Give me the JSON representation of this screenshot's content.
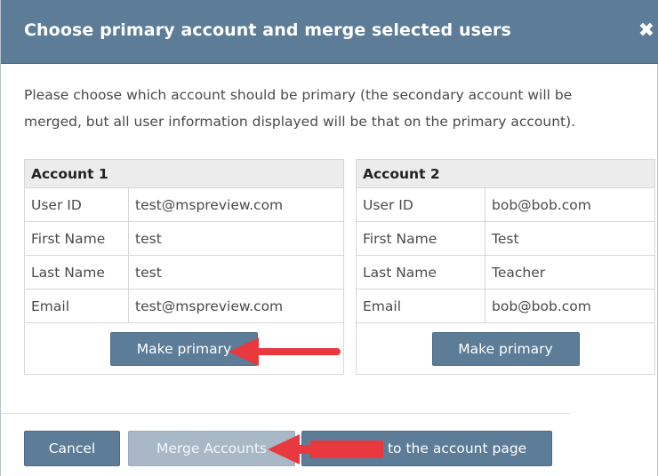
{
  "dialog": {
    "title": "Choose primary account and merge selected users",
    "close_symbol": "✖",
    "description": "Please choose which account should be primary (the secondary account will be merged, but all user information displayed will be that on the primary account)."
  },
  "accounts": [
    {
      "heading": "Account 1",
      "fields": [
        {
          "label": "User ID",
          "value": "test@mspreview.com"
        },
        {
          "label": "First Name",
          "value": "test"
        },
        {
          "label": "Last Name",
          "value": "test"
        },
        {
          "label": "Email",
          "value": "test@mspreview.com"
        }
      ],
      "button_label": "Make primary"
    },
    {
      "heading": "Account 2",
      "fields": [
        {
          "label": "User ID",
          "value": "bob@bob.com"
        },
        {
          "label": "First Name",
          "value": "Test"
        },
        {
          "label": "Last Name",
          "value": "Teacher"
        },
        {
          "label": "Email",
          "value": "bob@bob.com"
        }
      ],
      "button_label": "Make primary"
    }
  ],
  "footer": {
    "cancel_label": "Cancel",
    "merge_label": "Merge Accounts",
    "back_label": "Go back to the account page"
  },
  "colors": {
    "header_bg": "#5c7c98",
    "button_bg": "#5c7c98",
    "disabled_button_bg": "#a8b8c6",
    "annotation_arrow": "#e8393f"
  }
}
